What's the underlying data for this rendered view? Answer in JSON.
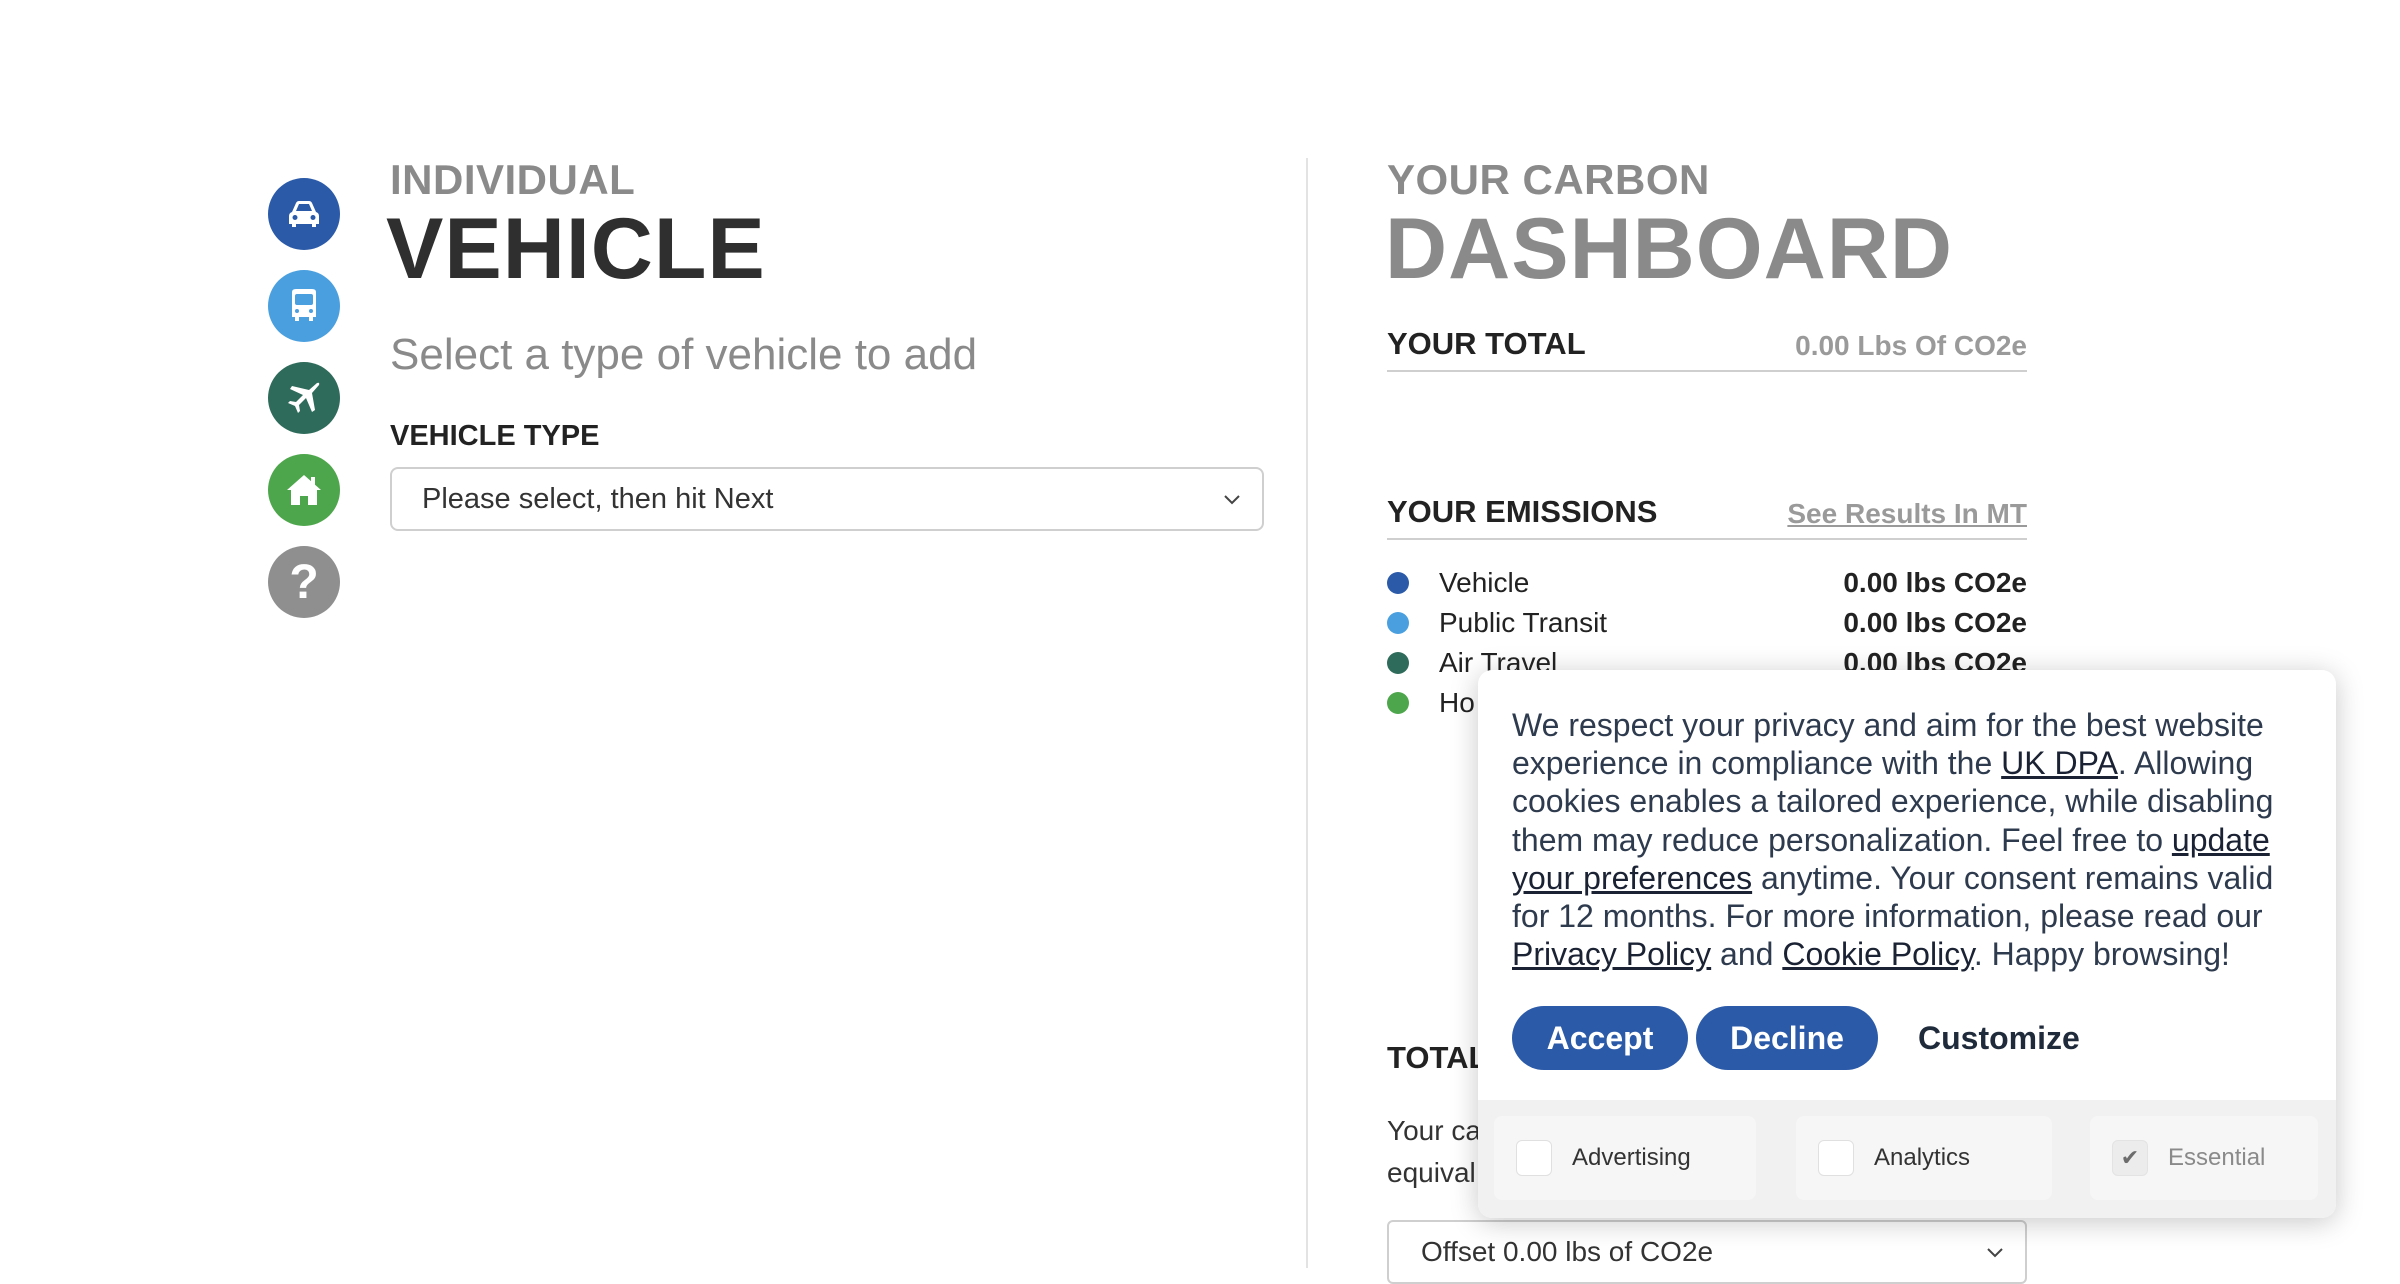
{
  "sidebar": {
    "icons": [
      {
        "name": "car-icon",
        "color": "#2b5aa8"
      },
      {
        "name": "bus-icon",
        "color": "#4a9fdf"
      },
      {
        "name": "airplane-icon",
        "color": "#2f6b5a"
      },
      {
        "name": "home-icon",
        "color": "#4ea64c"
      },
      {
        "name": "help-icon",
        "color": "#8f8f8f",
        "glyph": "?"
      }
    ]
  },
  "form": {
    "subtitle": "INDIVIDUAL",
    "title": "VEHICLE",
    "prompt": "Select a type of vehicle to add",
    "vehicle_type_label": "VEHICLE TYPE",
    "vehicle_type_value": "Please select, then hit Next"
  },
  "dashboard": {
    "subtitle": "YOUR CARBON",
    "title": "DASHBOARD",
    "total_label": "YOUR TOTAL",
    "total_value": "0.00 Lbs Of CO2e",
    "emissions_label": "YOUR EMISSIONS",
    "results_link": "See Results In MT",
    "emissions": [
      {
        "label": "Vehicle",
        "value": "0.00 lbs CO2e",
        "color": "#2b5aa8"
      },
      {
        "label": "Public Transit",
        "value": "0.00 lbs CO2e",
        "color": "#4a9fdf"
      },
      {
        "label": "Air Travel",
        "value": "0.00 lbs CO2e",
        "color": "#2f6b5a"
      },
      {
        "label": "Ho",
        "value": "",
        "color": "#4ea64c"
      }
    ],
    "total_section_label": "TOTAL",
    "total_text_line1": "Your ca",
    "total_text_line2": "equival",
    "offset_value": "Offset 0.00 lbs of CO2e"
  },
  "cookie": {
    "text_1": "We respect your privacy and aim for the best website experience in compliance with the ",
    "link_dpa": "UK DPA",
    "text_2": ". Allowing cookies enables a tailored experience, while disabling them may reduce personalization. Feel free to ",
    "link_prefs": "update your preferences",
    "text_3": " anytime. Your consent remains valid for 12 months. For more information, please read our ",
    "link_privacy": "Privacy Policy",
    "text_4": " and ",
    "link_cookie": "Cookie Policy",
    "text_5": ". Happy browsing!",
    "accept": "Accept",
    "decline": "Decline",
    "customize": "Customize",
    "options": [
      {
        "label": "Advertising",
        "checked": false
      },
      {
        "label": "Analytics",
        "checked": false
      },
      {
        "label": "Essential",
        "checked": true
      }
    ],
    "check_glyph": "✔"
  }
}
